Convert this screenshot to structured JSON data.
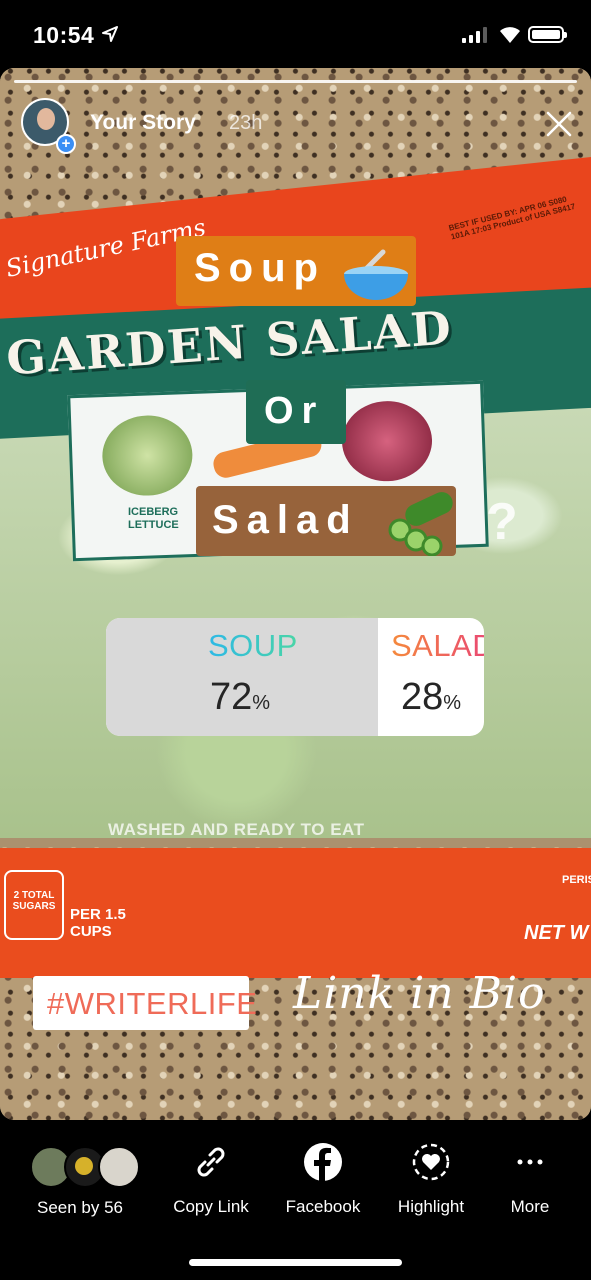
{
  "status_bar": {
    "time": "10:54"
  },
  "header": {
    "title": "Your Story",
    "time_ago": "23h"
  },
  "stickers": {
    "soup": "Soup",
    "or": "Or",
    "salad": "Salad",
    "question_mark": "?"
  },
  "poll": {
    "options": [
      {
        "label": "SOUP",
        "percent": "72",
        "unit": "%"
      },
      {
        "label": "SALAD",
        "percent": "28",
        "unit": "%"
      }
    ]
  },
  "hashtag": "#WRITERLIFE",
  "link_text": "Link in Bio",
  "photo_text": {
    "brand": "Signature Farms",
    "product": "GARDEN SALAD",
    "best_if": "BEST IF USED BY: APR 06 S080 101A 17:03 Product of USA S8417",
    "iceberg": "ICEBERG LETTUCE",
    "washed": "WASHED AND READY TO EAT",
    "sugars": "2 TOTAL SUGARS",
    "per": "PER 1.5 CUPS",
    "net_wt": "NET W",
    "peris": "PERIS"
  },
  "actions": {
    "seen_by": "Seen by 56",
    "copy_link": "Copy Link",
    "facebook": "Facebook",
    "highlight": "Highlight",
    "more": "More"
  },
  "colors": {
    "soup_tag": "#df7e16",
    "or_tag": "#1f6d55",
    "salad_tag": "#97633b",
    "hashtag_text": "#ef6b58",
    "plus_badge": "#3b8ff5"
  }
}
